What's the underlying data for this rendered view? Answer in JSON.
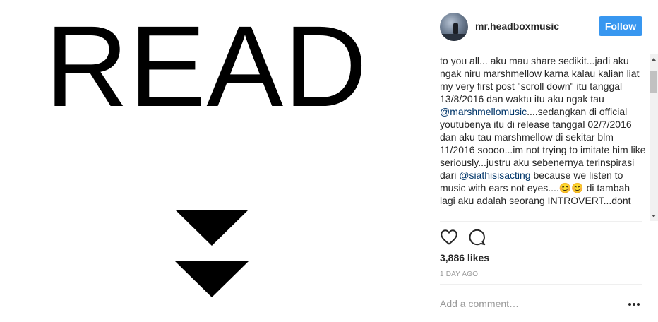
{
  "post": {
    "image": {
      "word": "READ",
      "arrows_icon": "double-down-triangle"
    },
    "header": {
      "username": "mr.headboxmusic",
      "follow_label": "Follow",
      "avatar_icon": "user-avatar"
    },
    "caption": {
      "segments": [
        {
          "text": "to you all... aku mau share sedikit...jadi aku ngak niru marshmellow karna kalau kalian liat my very first post \"scroll down\" itu tanggal 13/8/2016 dan waktu itu aku ngak tau ",
          "mention": false
        },
        {
          "text": "@marshmellomusic",
          "mention": true
        },
        {
          "text": "....sedangkan di official youtubenya itu di release tanggal 02/7/2016 dan aku tau marshmellow di sekitar blm 11/2016 soooo...im not trying to imitate him like seriously...justru aku sebenernya terinspirasi dari ",
          "mention": false
        },
        {
          "text": "@siathisisacting",
          "mention": true
        },
        {
          "text": " because we listen to music with ears not eyes....😊😊 di tambah lagi aku adalah seorang INTROVERT...dont",
          "mention": false
        }
      ]
    },
    "actions": {
      "like_icon": "heart-icon",
      "comment_icon": "comment-bubble-icon"
    },
    "likes": "3,886 likes",
    "timestamp": "1 DAY AGO",
    "comment": {
      "placeholder": "Add a comment…",
      "more_icon": "more-options-icon"
    }
  },
  "colors": {
    "follow_button": "#3897f0",
    "mention": "#003569",
    "muted": "#999999",
    "text": "#262626"
  }
}
